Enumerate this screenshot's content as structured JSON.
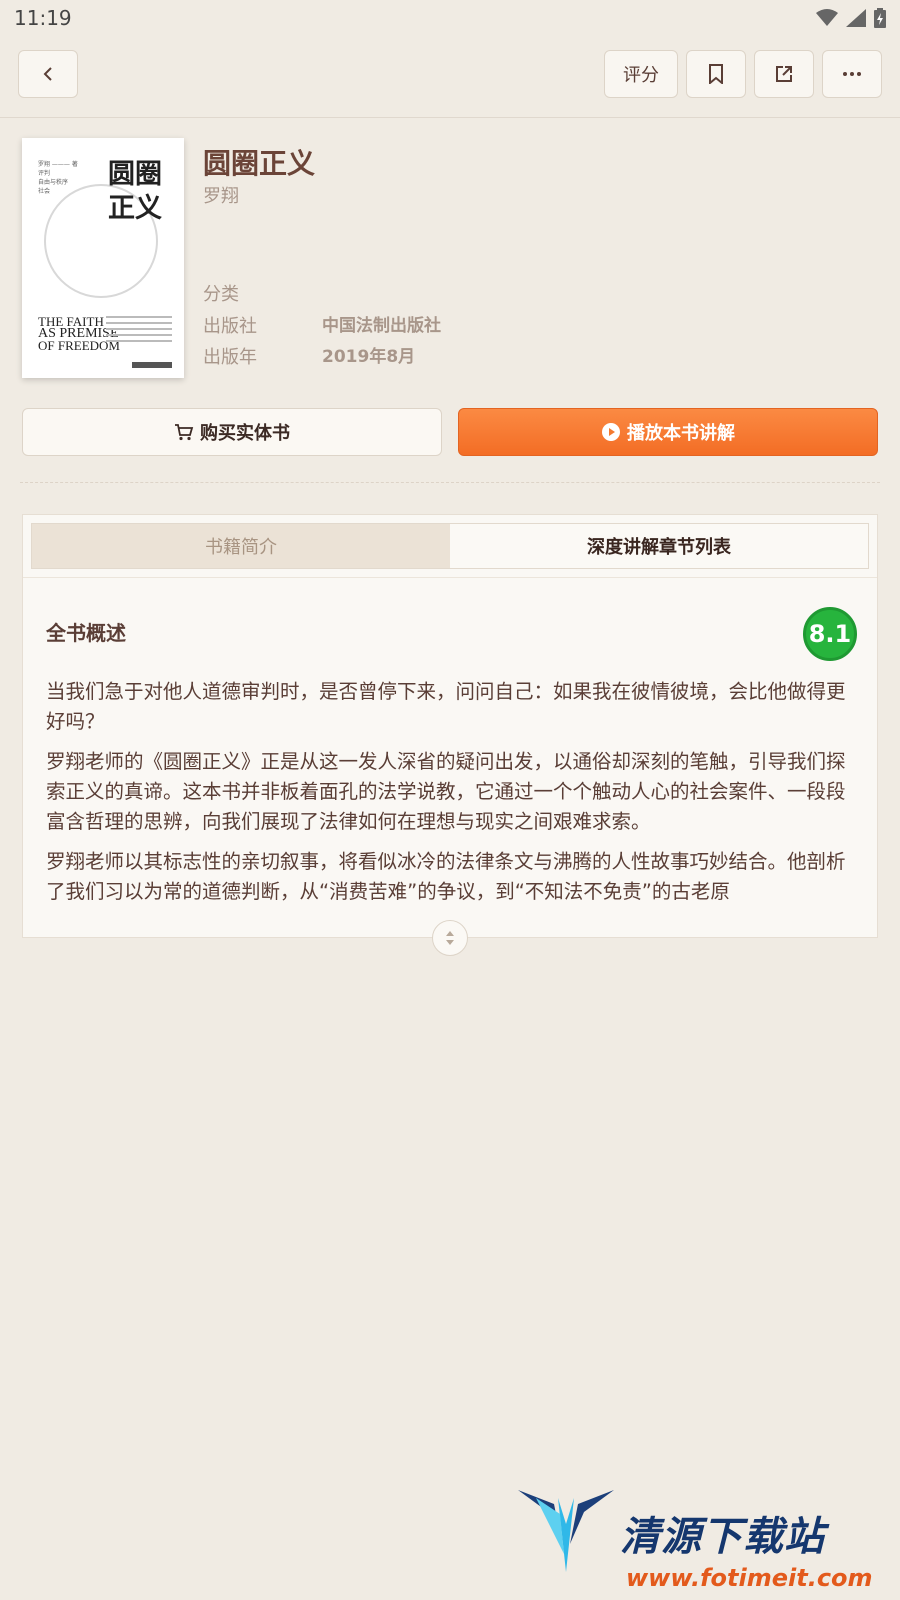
{
  "status_bar": {
    "time": "11:19"
  },
  "top_bar": {
    "rate_label": "评分"
  },
  "book": {
    "cover": {
      "title_line1": "圆圈",
      "title_line2": "正义",
      "en_line1": "THE FAITH",
      "en_line2": "AS PREMISE",
      "en_line3": "OF FREEDOM"
    },
    "title": "圆圈正义",
    "author": "罗翔",
    "meta": [
      {
        "label": "分类",
        "value": ""
      },
      {
        "label": "出版社",
        "value": "中国法制出版社"
      },
      {
        "label": "出版年",
        "value": "2019年8月"
      }
    ]
  },
  "actions": {
    "buy_label": "购买实体书",
    "play_label": "播放本书讲解"
  },
  "tabs": [
    {
      "label": "书籍简介",
      "selected": false
    },
    {
      "label": "深度讲解章节列表",
      "selected": true
    }
  ],
  "overview": {
    "title": "全书概述",
    "score": "8.1",
    "paragraphs": [
      "当我们急于对他人道德审判时，是否曾停下来，问问自己：如果我在彼情彼境，会比他做得更好吗？",
      "罗翔老师的《圆圈正义》正是从这一发人深省的疑问出发，以通俗却深刻的笔触，引导我们探索正义的真谛。这本书并非板着面孔的法学说教，它通过一个个触动人心的社会案件、一段段富含哲理的思辨，向我们展现了法律如何在理想与现实之间艰难求索。",
      "罗翔老师以其标志性的亲切叙事，将看似冰冷的法律条文与沸腾的人性故事巧妙结合。他剖析了我们习以为常的道德判断，从“消费苦难”的争议，到“不知法不免责”的古老原"
    ]
  },
  "watermark": {
    "name": "清源下载站",
    "url": "www.fotimeit.com"
  },
  "colors": {
    "background": "#f0ebe3",
    "accent_orange": "#f47a30",
    "score_green": "#27b43d",
    "text_brown": "#5a3e36"
  }
}
